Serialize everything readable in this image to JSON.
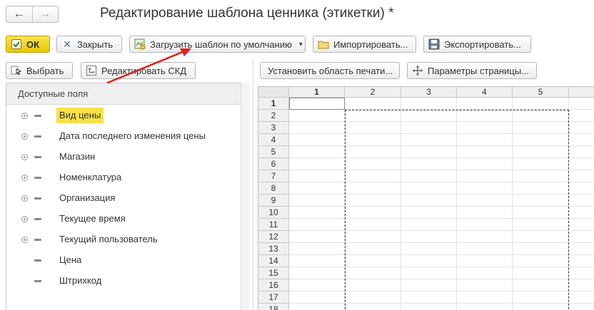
{
  "window": {
    "title": "Редактирование шаблона ценника (этикетки) *",
    "nav_back": "←",
    "nav_forward": "→"
  },
  "toolbar": {
    "ok_label": "ОК",
    "close_label": "Закрыть",
    "load_default_label": "Загрузить шаблон по умолчанию",
    "import_label": "Импортировать...",
    "export_label": "Экспортировать..."
  },
  "left_toolbar": {
    "select_label": "Выбрать",
    "edit_dcs_label": "Редактировать СКД"
  },
  "right_toolbar": {
    "set_print_area_label": "Установить область печати...",
    "page_params_label": "Параметры страницы..."
  },
  "fields_panel": {
    "header": "Доступные поля",
    "items": [
      {
        "label": "Вид цены",
        "expandable": true,
        "selected": true
      },
      {
        "label": "Дата последнего изменения цены",
        "expandable": true,
        "selected": false
      },
      {
        "label": "Магазин",
        "expandable": true,
        "selected": false
      },
      {
        "label": "Номенклатура",
        "expandable": true,
        "selected": false
      },
      {
        "label": "Организация",
        "expandable": true,
        "selected": false
      },
      {
        "label": "Текущее время",
        "expandable": true,
        "selected": false
      },
      {
        "label": "Текущий пользователь",
        "expandable": true,
        "selected": false
      },
      {
        "label": "Цена",
        "expandable": false,
        "selected": false
      },
      {
        "label": "Штрихкод",
        "expandable": false,
        "selected": false
      }
    ]
  },
  "sheet": {
    "columns": [
      "1",
      "2",
      "3",
      "4",
      "5"
    ],
    "rows": [
      "1",
      "2",
      "3",
      "4",
      "5",
      "6",
      "7",
      "8",
      "9",
      "10",
      "11",
      "12",
      "13",
      "14",
      "15",
      "16",
      "17",
      "18"
    ],
    "active_column": "1",
    "active_row": "1"
  },
  "colors": {
    "ok_button": "#f0d42a",
    "selection": "#f7e14a",
    "annotation_arrow": "#e0201b"
  }
}
